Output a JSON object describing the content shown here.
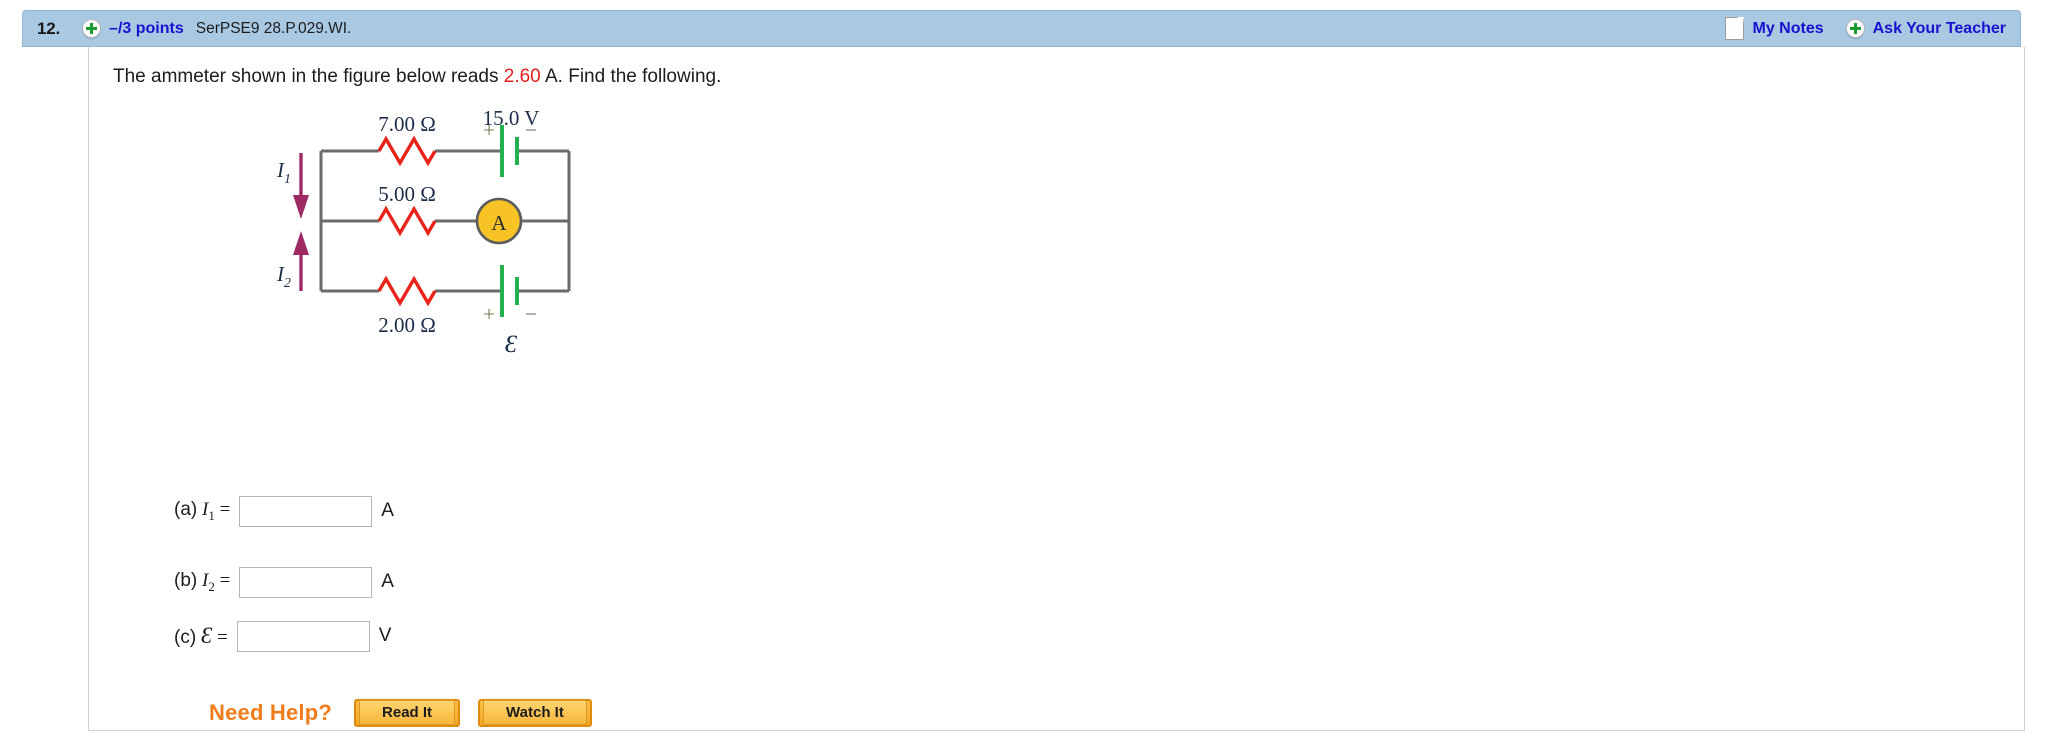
{
  "header": {
    "question_number": "12.",
    "points": "–/3 points",
    "question_code": "SerPSE9 28.P.029.WI.",
    "my_notes_label": "My Notes",
    "ask_teacher_label": "Ask Your Teacher",
    "bar_color": "#a9c9e3",
    "link_color": "#1a11d0"
  },
  "question": {
    "text_before": "The ammeter shown in the figure below reads ",
    "reading_value": "2.60",
    "text_after": " A. Find the following.",
    "highlight_color": "#e02020"
  },
  "figure": {
    "name": "circuit-diagram",
    "resistor_top": "7.00 Ω",
    "resistor_middle": "5.00 Ω",
    "resistor_bottom": "2.00 Ω",
    "battery_top_label": "15.0 V",
    "battery_bottom_label": "Ɛ",
    "ammeter_label": "A",
    "current_1_label": "I",
    "current_1_sub": "1",
    "current_2_label": "I",
    "current_2_sub": "2",
    "plus_sign": "+",
    "minus_sign": "−",
    "wire_color": "#6b6b6b",
    "resistor_color": "#e8231a",
    "battery_color": "#22b14c",
    "ammeter_fill": "#f7c325",
    "ammeter_stroke": "#5c5c5c",
    "arrow_color": "#9e2a63"
  },
  "answers": [
    {
      "part": "(a)",
      "symbol": "I",
      "sub": "1",
      "eq": "=",
      "value": "",
      "placeholder": "",
      "unit": "A"
    },
    {
      "part": "(b)",
      "symbol": "I",
      "sub": "2",
      "eq": "=",
      "value": "",
      "placeholder": "",
      "unit": "A"
    },
    {
      "part": "(c)",
      "symbol": "Ɛ",
      "sub": "",
      "eq": "=",
      "value": "",
      "placeholder": "",
      "unit": "V"
    }
  ],
  "need_help": {
    "label": "Need Help?",
    "read_it": "Read It",
    "watch_it": "Watch It",
    "accent_color": "#f07c1c"
  }
}
